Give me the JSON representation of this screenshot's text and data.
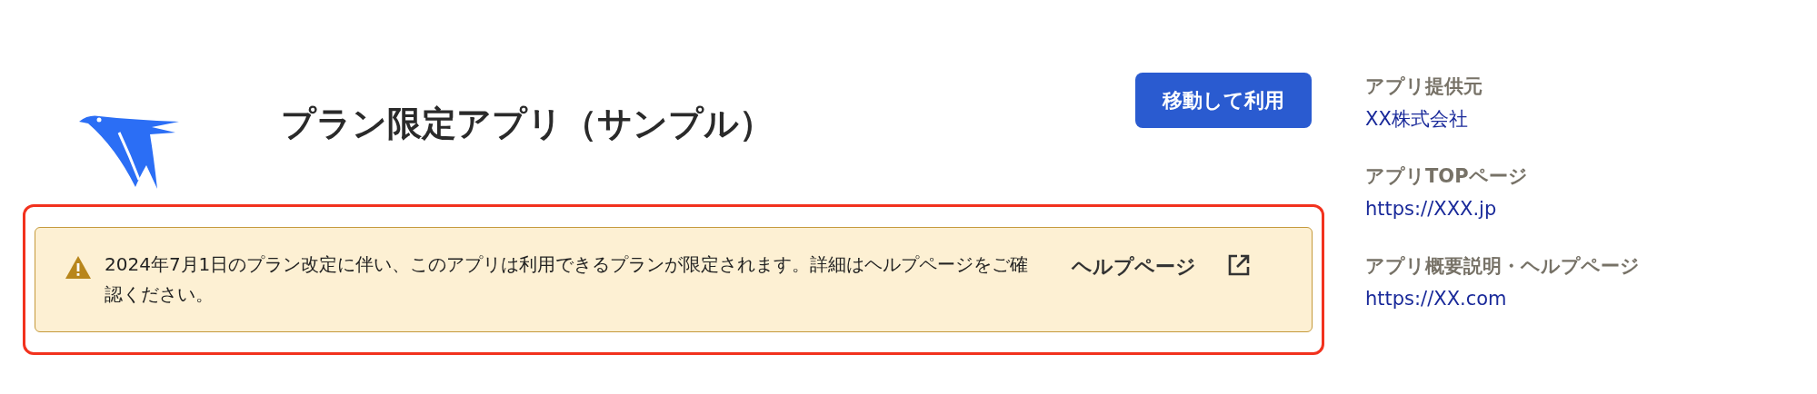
{
  "app": {
    "title": "プラン限定アプリ（サンプル）",
    "action_button": "移動して利用"
  },
  "notice": {
    "kind": "warning",
    "outlined": true,
    "message": "2024年7月1日のプラン改定に伴い、このアプリは利用できるプランが限定されます。詳細はヘルプページをご確認ください。",
    "link": "ヘルプページ"
  },
  "sidebar": {
    "items": [
      {
        "label": "アプリ提供元",
        "value": "XX株式会社"
      },
      {
        "label": "アプリTOPページ",
        "value": "https://XXX.jp"
      },
      {
        "label": "アプリ概要説明・ヘルプページ",
        "value": "https://XX.com"
      }
    ]
  }
}
